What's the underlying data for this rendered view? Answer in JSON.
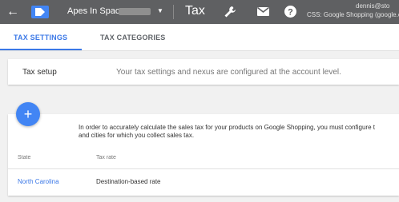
{
  "header": {
    "back_icon": "arrow-left-icon",
    "logo_icon": "tag-icon",
    "account_name": "Apes In Space",
    "page_title": "Tax",
    "user_email": "dennis@sto",
    "user_subtitle": "CSS: Google Shopping (google.c"
  },
  "tabs": [
    {
      "label": "TAX SETTINGS",
      "active": true
    },
    {
      "label": "TAX CATEGORIES",
      "active": false
    }
  ],
  "tax_setup": {
    "label": "Tax setup",
    "description": "Your tax settings and nexus are configured at the account level."
  },
  "nexus": {
    "add_button": "+",
    "info_line1": "In order to accurately calculate the sales tax for your products on Google Shopping, you must configure t",
    "info_line2": "and cities for which you collect sales tax.",
    "columns": [
      "State",
      "Tax rate"
    ],
    "rows": [
      {
        "state": "North Carolina",
        "tax_rate": "Destination-based rate"
      }
    ]
  },
  "colors": {
    "topbar": "#5f6062",
    "accent": "#3b78e7",
    "fab": "#4285f4"
  }
}
